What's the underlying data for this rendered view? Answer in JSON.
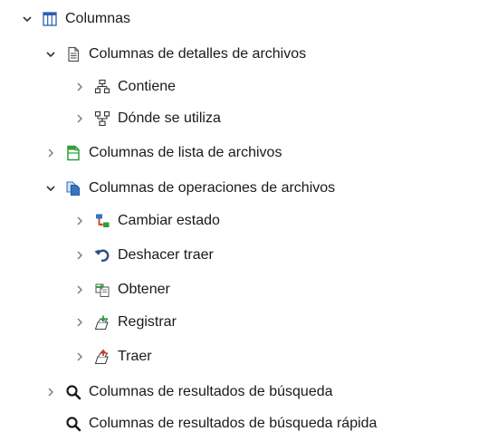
{
  "tree": {
    "items": [
      {
        "label": "Columnas",
        "icon": "columns-icon",
        "expanded": true
      },
      {
        "label": "Columnas de detalles de archivos",
        "icon": "file-details-icon",
        "expanded": true
      },
      {
        "label": "Contiene",
        "icon": "contains-hierarchy-icon",
        "expanded": false
      },
      {
        "label": "Dónde se utiliza",
        "icon": "where-used-hierarchy-icon",
        "expanded": false
      },
      {
        "label": "Columnas de lista de archivos",
        "icon": "file-list-icon",
        "expanded": false
      },
      {
        "label": "Columnas de operaciones de archivos",
        "icon": "file-operations-icon",
        "expanded": true
      },
      {
        "label": "Cambiar estado",
        "icon": "change-state-icon",
        "expanded": false
      },
      {
        "label": "Deshacer traer",
        "icon": "undo-checkout-icon",
        "expanded": false
      },
      {
        "label": "Obtener",
        "icon": "get-icon",
        "expanded": false
      },
      {
        "label": "Registrar",
        "icon": "check-in-icon",
        "expanded": false
      },
      {
        "label": "Traer",
        "icon": "check-out-icon",
        "expanded": false
      },
      {
        "label": "Columnas de resultados de búsqueda",
        "icon": "search-icon",
        "expanded": false
      },
      {
        "label": "Columnas de resultados de búsqueda rápida",
        "icon": "search-icon",
        "expanded": null
      }
    ]
  },
  "colors": {
    "text": "#1a1a1a",
    "chevron": "#6f6f6f",
    "accent_blue": "#3a73c4",
    "accent_green": "#2f9e3a",
    "accent_red": "#d23a2a"
  }
}
